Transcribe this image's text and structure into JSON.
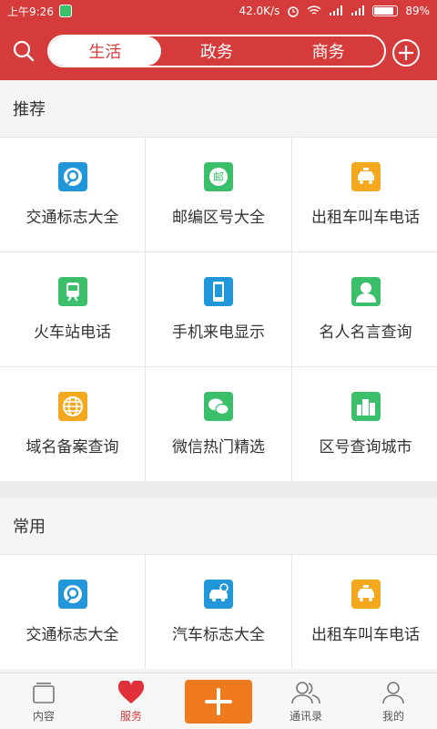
{
  "status": {
    "time": "上午9:26",
    "speed": "42.0K/s",
    "battery": "89%",
    "battery_level": 0.89
  },
  "header": {
    "tabs": [
      {
        "label": "生活",
        "active": true
      },
      {
        "label": "政务",
        "active": false
      },
      {
        "label": "商务",
        "active": false
      }
    ]
  },
  "sections": {
    "recommended": {
      "title": "推荐",
      "items": [
        {
          "label": "交通标志大全",
          "icon": "traffic-sign-icon",
          "color": "#2196d8"
        },
        {
          "label": "邮编区号大全",
          "icon": "postcode-icon",
          "color": "#3bbf6a",
          "glyph": "邮"
        },
        {
          "label": "出租车叫车电话",
          "icon": "taxi-icon",
          "color": "#f4a81d"
        },
        {
          "label": "火车站电话",
          "icon": "train-icon",
          "color": "#3bbf6a"
        },
        {
          "label": "手机来电显示",
          "icon": "phone-icon",
          "color": "#2196d8"
        },
        {
          "label": "名人名言查询",
          "icon": "person-icon",
          "color": "#3bbf6a"
        },
        {
          "label": "域名备案查询",
          "icon": "globe-icon",
          "color": "#f4a81d"
        },
        {
          "label": "微信热门精选",
          "icon": "wechat-icon",
          "color": "#3bbf6a"
        },
        {
          "label": "区号查询城市",
          "icon": "city-icon",
          "color": "#3bbf6a"
        }
      ]
    },
    "common": {
      "title": "常用",
      "items": [
        {
          "label": "交通标志大全",
          "icon": "traffic-sign-icon",
          "color": "#2196d8"
        },
        {
          "label": "汽车标志大全",
          "icon": "car-icon",
          "color": "#2196d8"
        },
        {
          "label": "出租车叫车电话",
          "icon": "taxi-icon",
          "color": "#f4a81d"
        }
      ]
    }
  },
  "tabbar": {
    "items": [
      {
        "label": "内容",
        "icon": "content-icon",
        "active": false
      },
      {
        "label": "服务",
        "icon": "heart-icon",
        "active": true
      },
      {
        "label": "",
        "icon": "plus-icon",
        "active": false
      },
      {
        "label": "通讯录",
        "icon": "contacts-icon",
        "active": false
      },
      {
        "label": "我的",
        "icon": "profile-icon",
        "active": false
      }
    ]
  },
  "colors": {
    "brand_red": "#d63b3b",
    "orange": "#f07b1f"
  }
}
